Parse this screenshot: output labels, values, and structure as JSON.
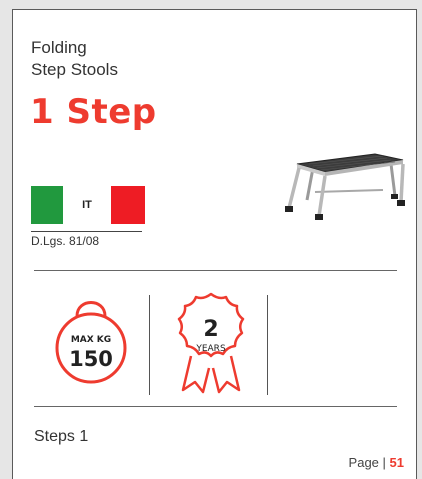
{
  "header": {
    "subtitle_line1": "Folding",
    "subtitle_line2": "Step Stools",
    "title": "1 Step"
  },
  "certification": {
    "country_code": "IT",
    "flag_colors": [
      "#21993e",
      "#ffffff",
      "#ee1c24"
    ],
    "norm": "D.Lgs. 81/08"
  },
  "badges": {
    "max_load_label": "MAX KG",
    "max_load_value": "150",
    "warranty_value": "2",
    "warranty_unit": "YEARS"
  },
  "specs": {
    "steps_label": "Steps 1"
  },
  "footer": {
    "page_label": "Page |",
    "page_number": "51"
  },
  "colors": {
    "accent": "#ee3b2f",
    "frame": "#5a5a5a"
  },
  "icons": [
    "step-stool-image",
    "weight-icon",
    "warranty-rosette-icon"
  ]
}
